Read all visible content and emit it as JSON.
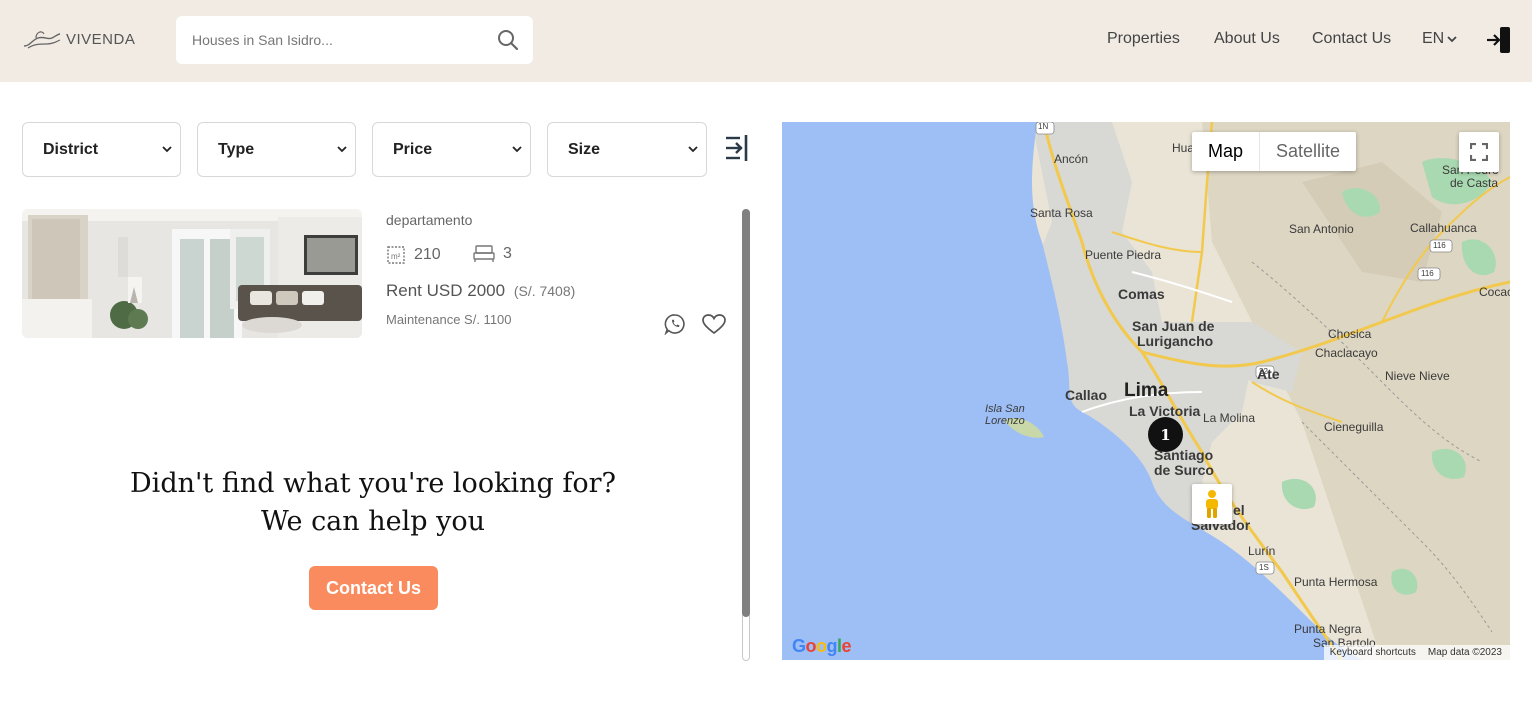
{
  "header": {
    "logo_text": "VIVENDA",
    "search_placeholder": "Houses in San Isidro...",
    "nav": [
      "Properties",
      "About Us",
      "Contact Us"
    ],
    "language": "EN"
  },
  "filters": [
    "District",
    "Type",
    "Price",
    "Size"
  ],
  "listing": {
    "type": "departamento",
    "area": "210",
    "bedrooms": "3",
    "price": "Rent USD 2000",
    "price_pen": "(S/. 7408)",
    "maintenance": "Maintenance S/. 1100"
  },
  "cta": {
    "line1": "Didn't find what you're looking for?",
    "line2": "We can help you",
    "button": "Contact Us"
  },
  "map": {
    "toggle": [
      "Map",
      "Satellite"
    ],
    "active_view": "Map",
    "marker_count": "1",
    "footer_shortcuts": "Keyboard shortcuts",
    "footer_data": "Map data ©2023",
    "google_logo": "Google",
    "places": {
      "ancon": "Ancón",
      "santa_rosa": "Santa Rosa",
      "puente_piedra": "Puente Piedra",
      "comas": "Comas",
      "sjl1": "San Juan de",
      "sjl2": "Lurigancho",
      "lima": "Lima",
      "callao": "Callao",
      "la_victoria": "La Victoria",
      "ate": "Ate",
      "la_molina": "La Molina",
      "isla1": "Isla San",
      "isla2": "Lorenzo",
      "santiago1": "Santiago",
      "santiago2": "de Surco",
      "salvador1": "el",
      "salvador2": "Salvador",
      "lurin": "Lurín",
      "punta_hermosa": "Punta Hermosa",
      "punta_negra": "Punta Negra",
      "san_bartolo": "San Bartolo",
      "san_antonio": "San Antonio",
      "callahuanca": "Callahuanca",
      "san_pedro1": "San Pedro",
      "san_pedro2": "de Casta",
      "chosica": "Chosica",
      "chaclacayo": "Chaclacayo",
      "nieve_nieve": "Nieve Nieve",
      "cieneguilla": "Cieneguilla",
      "cocachacra": "Cocac",
      "hua": "Hua",
      "r1n": "1N",
      "r1s": "1S",
      "r22": "22",
      "r116a": "116",
      "r116b": "116"
    }
  },
  "colors": {
    "header_bg": "#f1ebe4",
    "accent": "#f98b5e",
    "water": "#9ebff5",
    "land": "#e9e4d6",
    "urban": "#d8d8d4",
    "park": "#a9d9b0",
    "roads": "#f2c94c"
  }
}
